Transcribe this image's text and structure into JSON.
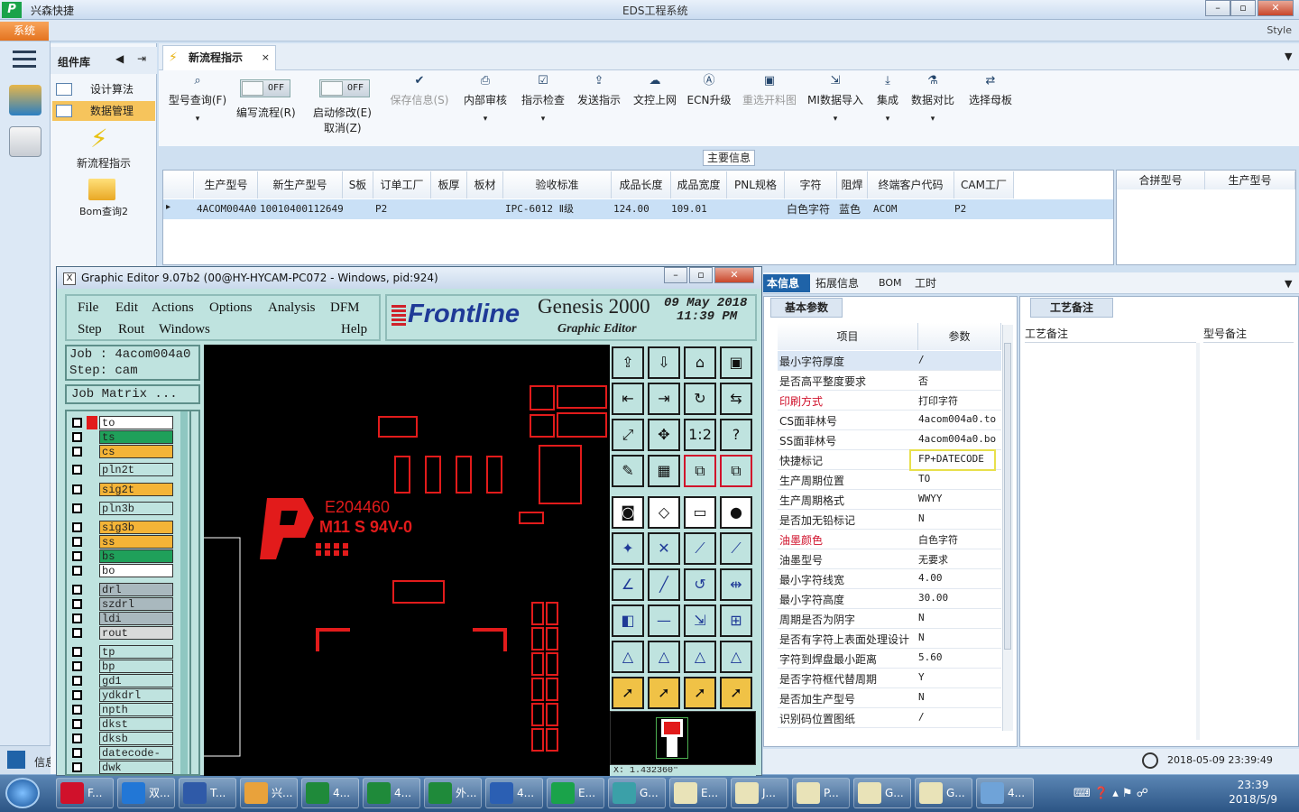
{
  "app": {
    "name": "兴森快捷",
    "title": "EDS工程系统",
    "system_button": "系统",
    "style_label": "Style"
  },
  "sidebar": {
    "header": "组件库",
    "items": [
      {
        "label": "设计算法"
      },
      {
        "label": "数据管理"
      },
      {
        "label": "新流程指示"
      },
      {
        "label": "Bom查询2"
      }
    ],
    "bottom_label": "信息"
  },
  "tab": {
    "label": "新流程指示",
    "close": "×"
  },
  "toolbar": {
    "buttons": [
      {
        "label": "型号查询(F)",
        "icon": "search-icon"
      },
      {
        "label": "编写流程(R)",
        "toggle": "OFF"
      },
      {
        "label": "启动修改(E)",
        "label2": "取消(Z)",
        "toggle": "OFF"
      },
      {
        "label": "保存信息(S)",
        "icon": "check-icon"
      },
      {
        "label": "内部审核",
        "icon": "print-icon"
      },
      {
        "label": "指示检查",
        "icon": "checkbox-icon"
      },
      {
        "label": "发送指示",
        "icon": "upload-icon"
      },
      {
        "label": "文控上网",
        "icon": "cloud-upload-icon"
      },
      {
        "label": "ECN升级",
        "icon": "ecn-icon"
      },
      {
        "label": "重选开料图",
        "icon": "image-icon"
      },
      {
        "label": "MI数据导入",
        "icon": "import-icon"
      },
      {
        "label": "集成",
        "icon": "download-icon"
      },
      {
        "label": "数据对比",
        "icon": "compare-icon"
      },
      {
        "label": "选择母板",
        "icon": "shuffle-icon"
      }
    ]
  },
  "main_info": {
    "label": "主要信息",
    "columns": [
      "生产型号",
      "新生产型号",
      "S板",
      "订单工厂",
      "板厚",
      "板材",
      "验收标准",
      "成品长度",
      "成品宽度",
      "PNL规格",
      "字符",
      "阻焊",
      "终端客户代码",
      "CAM工厂"
    ],
    "row": [
      "4ACOM004A0",
      "10010400112649",
      "",
      "P2",
      "",
      "",
      "IPC-6012 Ⅱ级",
      "124.00",
      "109.01",
      "",
      "白色字符",
      "蓝色",
      "ACOM",
      "P2"
    ],
    "right_columns": [
      "合拼型号",
      "生产型号"
    ]
  },
  "detail_tabs": [
    "本信息",
    "拓展信息",
    "BOM",
    "工时"
  ],
  "params": {
    "title": "基本参数",
    "col_item": "项目",
    "col_value": "参数",
    "rows": [
      {
        "k": "最小字符厚度",
        "v": "/"
      },
      {
        "k": "是否高平整度要求",
        "v": "否"
      },
      {
        "k": "印刷方式",
        "v": "打印字符",
        "red": true
      },
      {
        "k": "CS面菲林号",
        "v": "4acom004a0.to"
      },
      {
        "k": "SS面菲林号",
        "v": "4acom004a0.bo"
      },
      {
        "k": "快捷标记",
        "v": "FP+DATECODE"
      },
      {
        "k": "生产周期位置",
        "v": "TO"
      },
      {
        "k": "生产周期格式",
        "v": "WWYY"
      },
      {
        "k": "是否加无铅标记",
        "v": "N"
      },
      {
        "k": "油墨颜色",
        "v": "白色字符",
        "red": true
      },
      {
        "k": "油墨型号",
        "v": "无要求"
      },
      {
        "k": "最小字符线宽",
        "v": "4.00"
      },
      {
        "k": "最小字符高度",
        "v": "30.00"
      },
      {
        "k": "周期是否为阴字",
        "v": "N"
      },
      {
        "k": "是否有字符上表面处理设计",
        "v": "N"
      },
      {
        "k": "字符到焊盘最小距离",
        "v": "5.60"
      },
      {
        "k": "是否字符框代替周期",
        "v": "Y"
      },
      {
        "k": "是否加生产型号",
        "v": "N"
      },
      {
        "k": "识别码位置图纸",
        "v": "/"
      }
    ]
  },
  "notes": {
    "tab": "工艺备注",
    "col1": "工艺备注",
    "col2": "型号备注"
  },
  "status": {
    "datetime": "2018-05-09 23:39:49"
  },
  "genesis": {
    "title": "Graphic Editor 9.07b2 (00@HY-HYCAM-PC072 - Windows, pid:924)",
    "menu_row1": [
      "File",
      "Edit",
      "Actions",
      "Options",
      "Analysis",
      "DFM"
    ],
    "menu_row2": [
      "Step",
      "Rout",
      "Windows",
      "Help"
    ],
    "brand": "Frontline",
    "product": "Genesis 2000",
    "subtitle": "Graphic Editor",
    "date": "09 May 2018",
    "time": "11:39 PM",
    "job": "Job : 4acom004a0",
    "step": "Step: cam",
    "job_matrix": "Job Matrix ...",
    "canvas_text1": "E204460",
    "canvas_text2": "M11 S 94V-0",
    "coord": "X: 1.432360\"",
    "layers": [
      {
        "name": "to",
        "color": "#ffffff"
      },
      {
        "name": "ts",
        "color": "#1fa05a"
      },
      {
        "name": "cs",
        "color": "#f4b437"
      },
      {
        "name": "pln2t",
        "color": "#bfe3df"
      },
      {
        "name": "sig2t",
        "color": "#f4b437"
      },
      {
        "name": "pln3b",
        "color": "#bfe3df"
      },
      {
        "name": "sig3b",
        "color": "#f4b437"
      },
      {
        "name": "ss",
        "color": "#f4b437"
      },
      {
        "name": "bs",
        "color": "#1fa05a"
      },
      {
        "name": "bo",
        "color": "#ffffff"
      },
      {
        "name": "drl",
        "color": "#a9b8be"
      },
      {
        "name": "szdrl",
        "color": "#a9b8be"
      },
      {
        "name": "ldi",
        "color": "#a9b8be"
      },
      {
        "name": "rout",
        "color": "#d8dada"
      },
      {
        "name": "tp",
        "color": "#bfe3df"
      },
      {
        "name": "bp",
        "color": "#bfe3df"
      },
      {
        "name": "gd1",
        "color": "#bfe3df"
      },
      {
        "name": "ydkdrl",
        "color": "#bfe3df"
      },
      {
        "name": "npth",
        "color": "#bfe3df"
      },
      {
        "name": "dkst",
        "color": "#bfe3df"
      },
      {
        "name": "dksb",
        "color": "#bfe3df"
      },
      {
        "name": "datecode-pt",
        "color": "#bfe3df"
      },
      {
        "name": "dwk",
        "color": "#bfe3df"
      }
    ]
  },
  "taskbar": {
    "items": [
      "F...",
      "双...",
      "T...",
      "兴...",
      "4...",
      "4...",
      "外...",
      "4...",
      "E...",
      "G...",
      "E...",
      "J...",
      "P...",
      "G...",
      "G...",
      "4..."
    ],
    "time": "23:39",
    "date": "2018/5/9"
  }
}
